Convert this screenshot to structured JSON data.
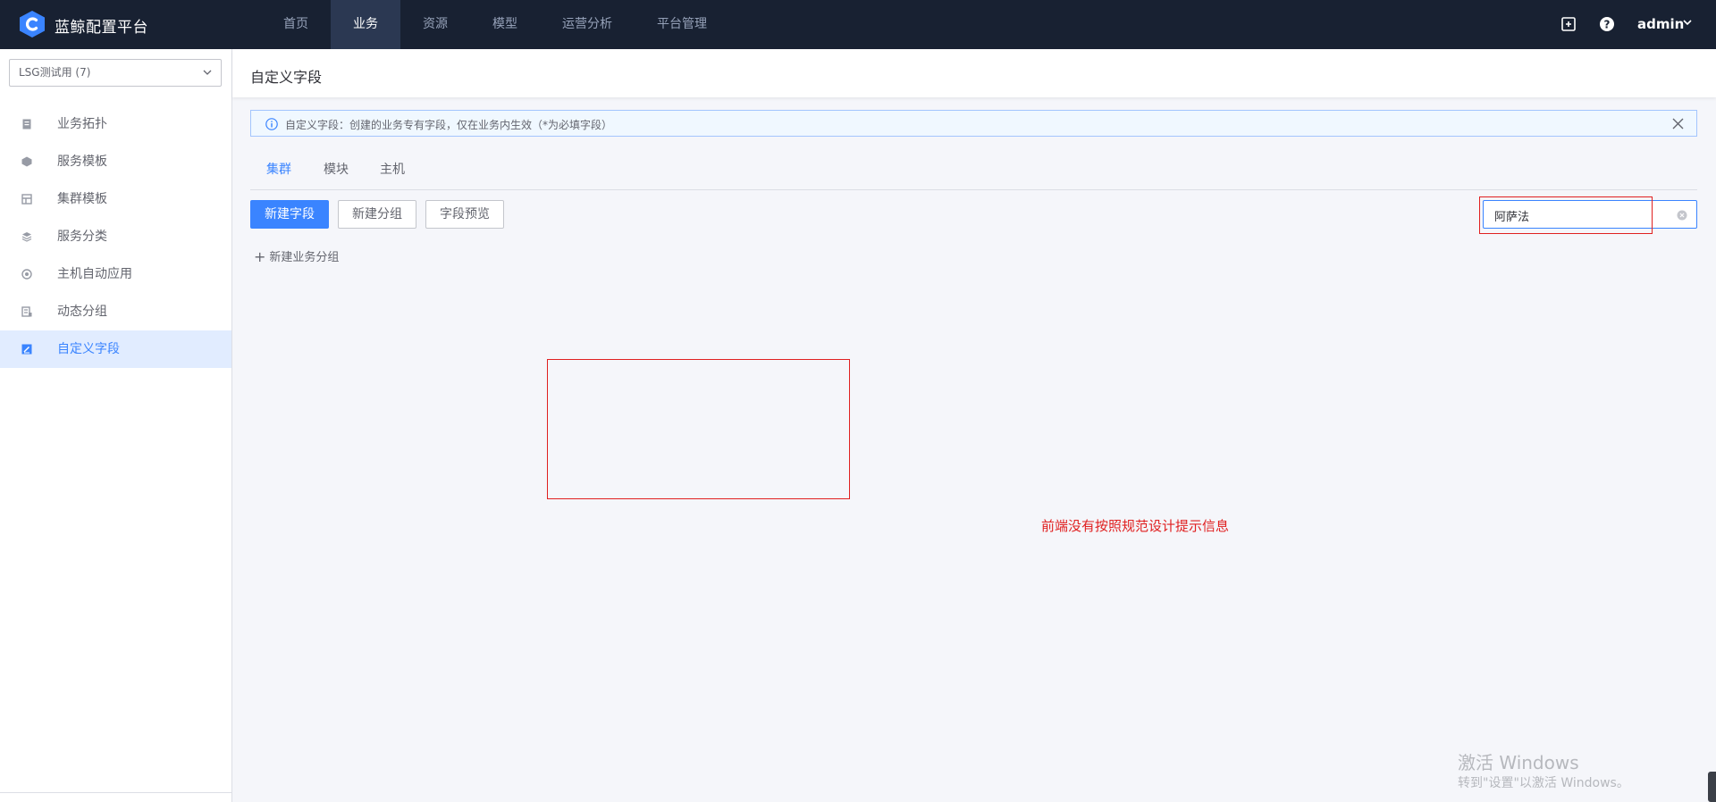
{
  "app": {
    "title": "蓝鲸配置平台",
    "colors": {
      "nav_bg": "#182132",
      "accent": "#3a84ff",
      "annotation": "#e02020"
    }
  },
  "topnav": {
    "items": [
      {
        "label": "首页",
        "active": false
      },
      {
        "label": "业务",
        "active": true
      },
      {
        "label": "资源",
        "active": false
      },
      {
        "label": "模型",
        "active": false
      },
      {
        "label": "运营分析",
        "active": false
      },
      {
        "label": "平台管理",
        "active": false
      }
    ],
    "icons": [
      "version-icon",
      "help-icon"
    ],
    "user": "admin"
  },
  "sidebar": {
    "business_select": "LSG测试用 (7)",
    "items": [
      {
        "label": "业务拓扑",
        "icon": "topology-icon",
        "active": false
      },
      {
        "label": "服务模板",
        "icon": "service-template-icon",
        "active": false
      },
      {
        "label": "集群模板",
        "icon": "cluster-template-icon",
        "active": false
      },
      {
        "label": "服务分类",
        "icon": "service-category-icon",
        "active": false
      },
      {
        "label": "主机自动应用",
        "icon": "host-auto-apply-icon",
        "active": false
      },
      {
        "label": "动态分组",
        "icon": "dynamic-group-icon",
        "active": false
      },
      {
        "label": "自定义字段",
        "icon": "custom-field-icon",
        "active": true
      }
    ]
  },
  "main": {
    "page_title": "自定义字段",
    "notice": "自定义字段：创建的业务专有字段，仅在业务内生效（*为必填字段）",
    "tabs": [
      {
        "label": "集群",
        "active": true
      },
      {
        "label": "模块",
        "active": false
      },
      {
        "label": "主机",
        "active": false
      }
    ],
    "buttons": {
      "new_field": "新建字段",
      "new_group": "新建分组",
      "preview": "字段预览"
    },
    "search_value": "阿萨法",
    "new_business_group": "新建业务分组"
  },
  "annotation": {
    "note": "前端没有按照规范设计提示信息"
  },
  "watermark": {
    "line1": "激活 Windows",
    "line2": "转到\"设置\"以激活 Windows。"
  }
}
